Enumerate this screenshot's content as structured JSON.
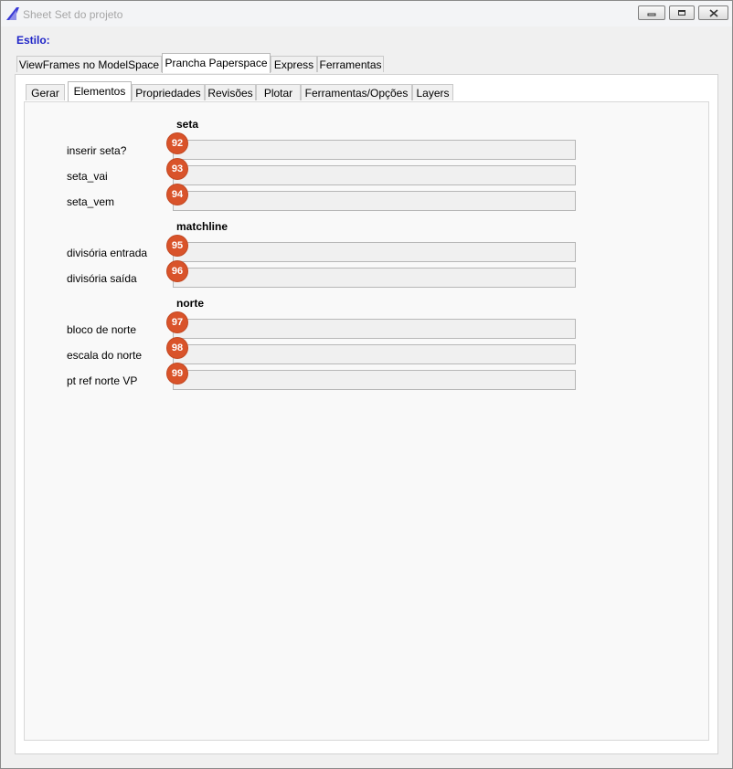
{
  "window": {
    "title": "Sheet Set do projeto"
  },
  "estilo_label": "Estilo:",
  "tabs_top": [
    {
      "label": "ViewFrames no ModelSpace"
    },
    {
      "label": "Prancha Paperspace"
    },
    {
      "label": "Express"
    },
    {
      "label": "Ferramentas"
    }
  ],
  "tabs_sub": [
    {
      "label": "Gerar"
    },
    {
      "label": "Elementos"
    },
    {
      "label": "Propriedades"
    },
    {
      "label": "Revisões"
    },
    {
      "label": "Plotar"
    },
    {
      "label": "Ferramentas/Opções"
    },
    {
      "label": "Layers"
    }
  ],
  "sections": [
    {
      "title": "seta",
      "fields": [
        {
          "label": "inserir seta?",
          "badge": "92",
          "value": ""
        },
        {
          "label": "seta_vai",
          "badge": "93",
          "value": ""
        },
        {
          "label": "seta_vem",
          "badge": "94",
          "value": ""
        }
      ]
    },
    {
      "title": "matchline",
      "fields": [
        {
          "label": "divisória entrada",
          "badge": "95",
          "value": ""
        },
        {
          "label": "divisória saída",
          "badge": "96",
          "value": ""
        }
      ]
    },
    {
      "title": "norte",
      "fields": [
        {
          "label": "bloco de norte",
          "badge": "97",
          "value": ""
        },
        {
          "label": "escala do norte",
          "badge": "98",
          "value": ""
        },
        {
          "label": "pt ref norte VP",
          "badge": "99",
          "value": ""
        }
      ]
    }
  ],
  "colors": {
    "accent": "#1f24c7",
    "badge": "#d9532a"
  }
}
